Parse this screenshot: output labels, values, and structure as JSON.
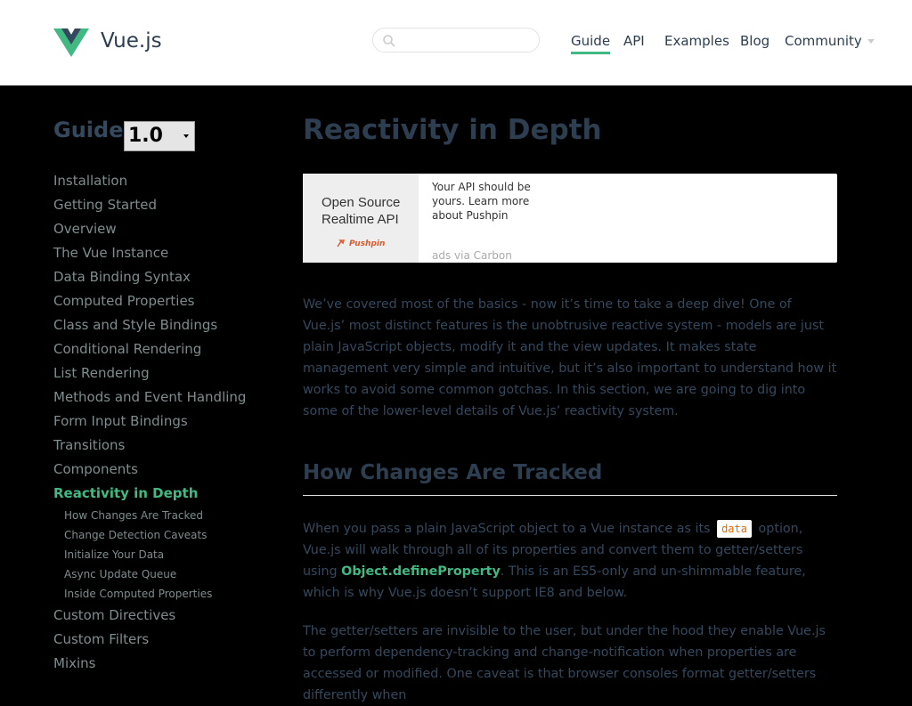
{
  "header": {
    "brand": "Vue.js",
    "search": {
      "placeholder": "",
      "value": ""
    },
    "nav": [
      {
        "label": "Guide",
        "active": true
      },
      {
        "label": "API"
      },
      {
        "label": "Examples"
      },
      {
        "label": "Blog"
      },
      {
        "label": "Community",
        "has_dropdown": true
      }
    ]
  },
  "sidebar": {
    "title": "Guide",
    "version": "1.0",
    "items": [
      "Installation",
      "Getting Started",
      "Overview",
      "The Vue Instance",
      "Data Binding Syntax",
      "Computed Properties",
      "Class and Style Bindings",
      "Conditional Rendering",
      "List Rendering",
      "Methods and Event Handling",
      "Form Input Bindings",
      "Transitions",
      "Components",
      "Reactivity in Depth"
    ],
    "sub_items": [
      "How Changes Are Tracked",
      "Change Detection Caveats",
      "Initialize Your Data",
      "Async Update Queue",
      "Inside Computed Properties"
    ],
    "items_after": [
      "Custom Directives",
      "Custom Filters",
      "Mixins"
    ]
  },
  "content": {
    "title": "Reactivity in Depth",
    "ad": {
      "image_line1": "Open Source",
      "image_line2": "Realtime API",
      "image_brand": "Pushpin",
      "text": "Your API should be yours. Learn more about Pushpin",
      "powered_by": "ads via Carbon"
    },
    "intro": "We’ve covered most of the basics - now it’s time to take a deep dive! One of Vue.js’ most distinct features is the unobtrusive reactive system - models are just plain JavaScript objects, modify it and the view updates. It makes state management very simple and intuitive, but it’s also important to understand how it works to avoid some common gotchas. In this section, we are going to dig into some of the lower-level details of Vue.js’ reactivity system.",
    "section_title": "How Changes Are Tracked",
    "p2_before": "When you pass a plain JavaScript object to a Vue instance as its",
    "p2_code": "data",
    "p2_mid": "option, Vue.js will walk through all of its properties and convert them to getter/setters using",
    "p2_link": "Object.defineProperty",
    "p2_after": ". This is an ES5-only and un-shimmable feature, which is why Vue.js doesn’t support IE8 and below.",
    "p3": "The getter/setters are invisible to the user, but under the hood they enable Vue.js to perform dependency-tracking and change-notification when properties are accessed or modified. One caveat is that browser consoles format getter/setters differently when"
  },
  "colors": {
    "accent": "#42b983",
    "text": "#34495e",
    "heading": "#2c3e50",
    "code": "#e96900"
  }
}
